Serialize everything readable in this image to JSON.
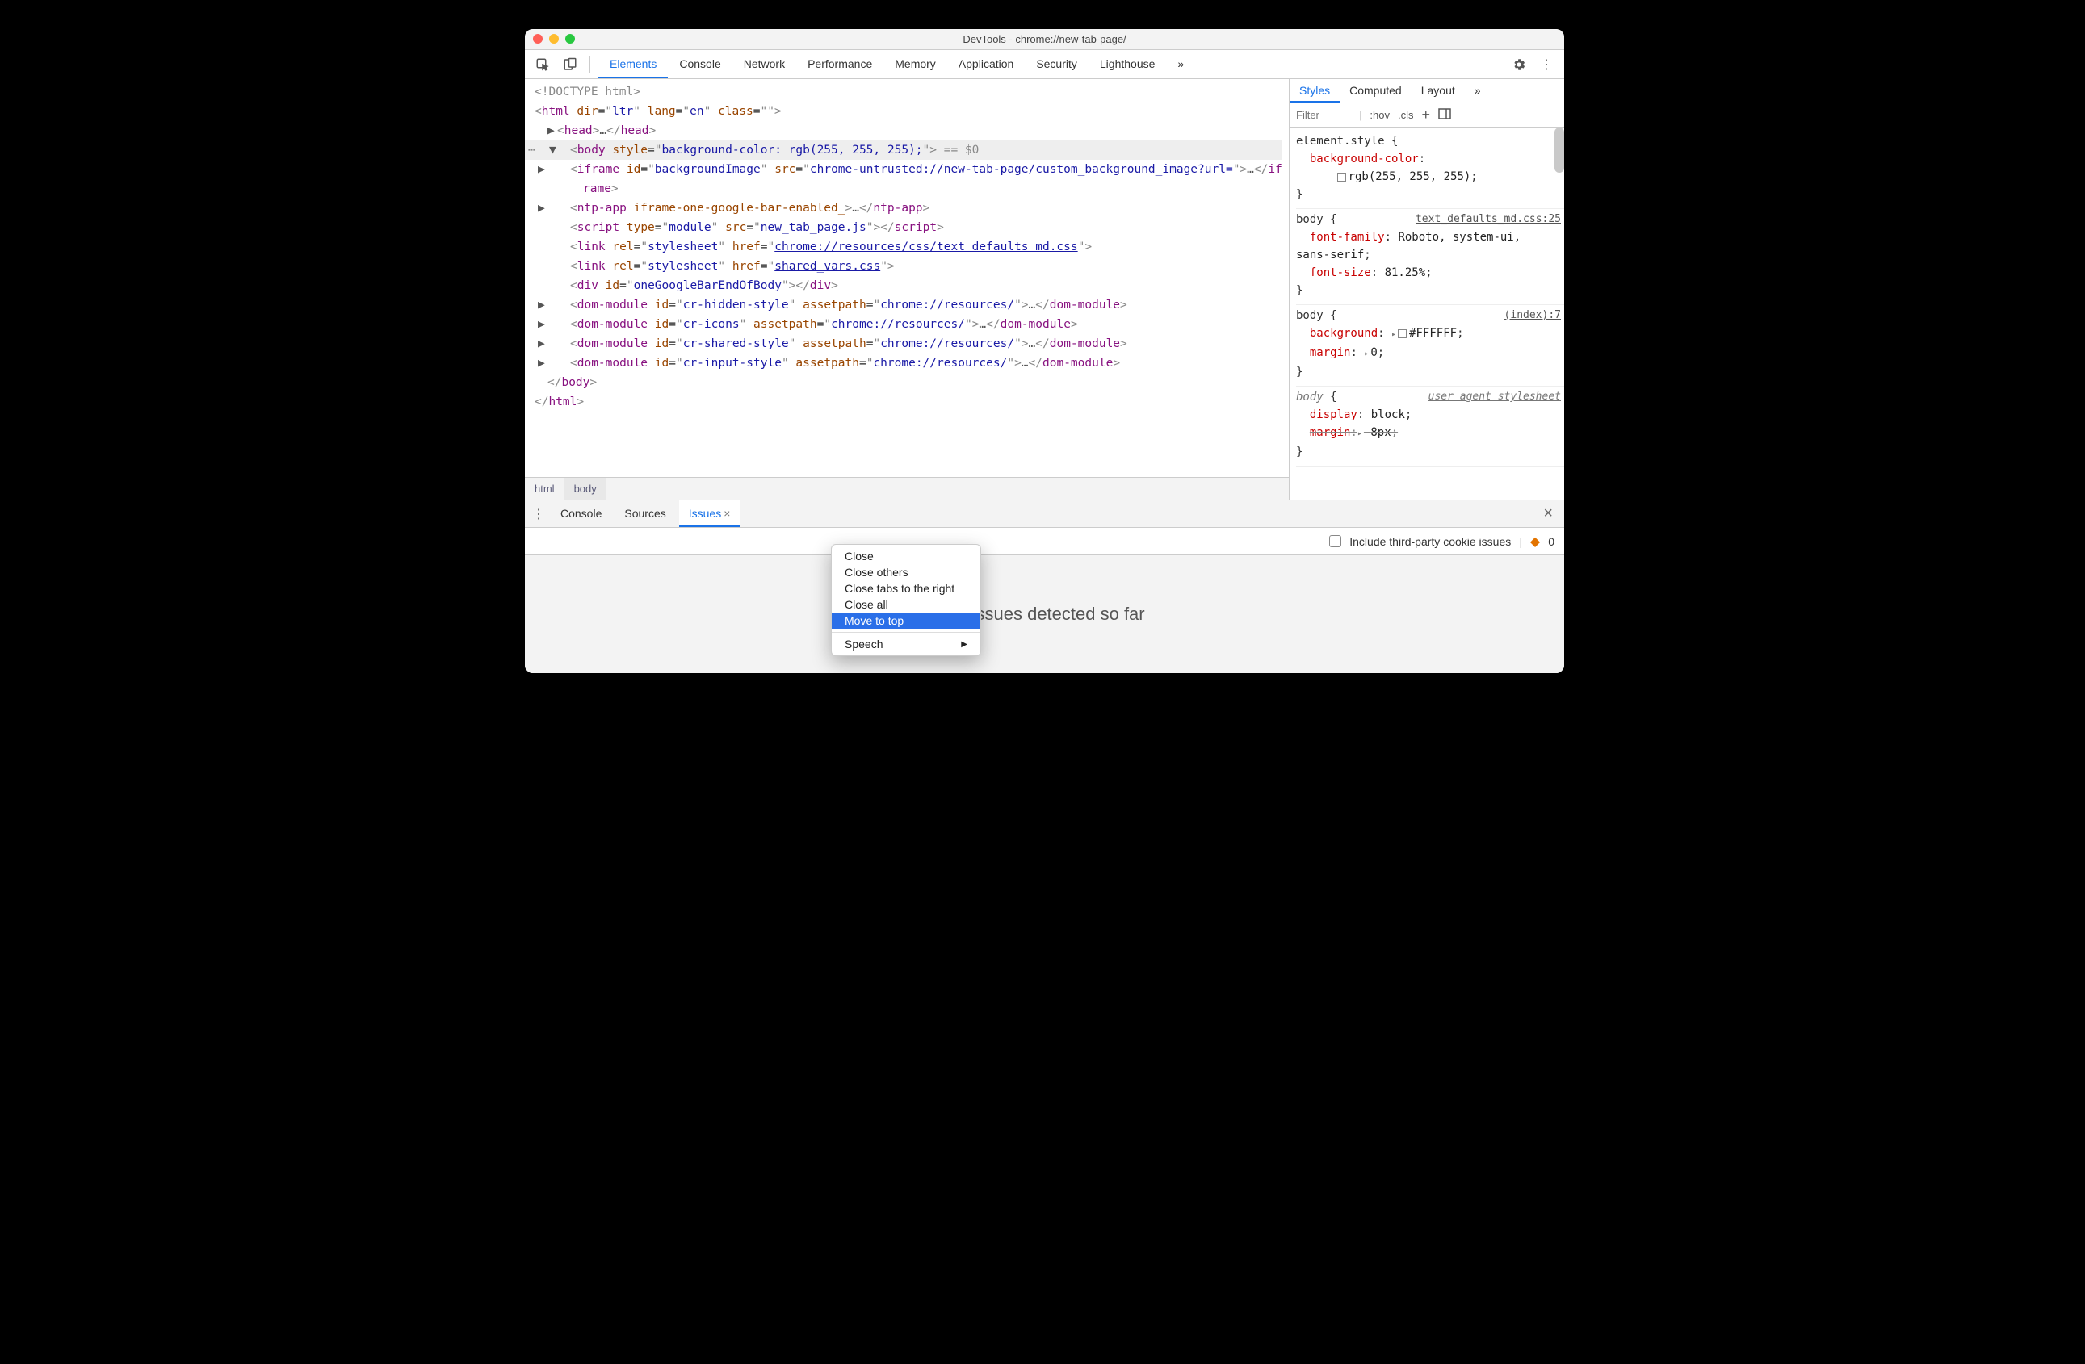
{
  "window": {
    "title": "DevTools - chrome://new-tab-page/"
  },
  "toolbar": {
    "tabs": [
      "Elements",
      "Console",
      "Network",
      "Performance",
      "Memory",
      "Application",
      "Security",
      "Lighthouse"
    ],
    "active": 0,
    "more": "»"
  },
  "dom": {
    "doctype": "<!DOCTYPE html>",
    "html_open": {
      "tag": "html",
      "attrs": [
        [
          "dir",
          "ltr"
        ],
        [
          "lang",
          "en"
        ],
        [
          "class",
          ""
        ]
      ]
    },
    "head": {
      "tag": "head",
      "ellipsis": "…"
    },
    "body": {
      "tag": "body",
      "style_attr": "background-color: rgb(255, 255, 255);",
      "suffix": " == $0"
    },
    "children": [
      {
        "open": "iframe",
        "attrs": [
          [
            "id",
            "backgroundImage"
          ],
          [
            "src",
            "chrome-untrusted://new-tab-page/custom_background_image?url=",
            "link"
          ]
        ],
        "ellipsis": "…",
        "close": "iframe",
        "arrow": true
      },
      {
        "open": "ntp-app",
        "attrs": [
          [
            "iframe-one-google-bar-enabled_",
            null
          ]
        ],
        "ellipsis": "…",
        "close": "ntp-app",
        "arrow": true
      },
      {
        "open": "script",
        "attrs": [
          [
            "type",
            "module"
          ],
          [
            "src",
            "new_tab_page.js",
            "link"
          ]
        ],
        "close": "script"
      },
      {
        "open": "link",
        "attrs": [
          [
            "rel",
            "stylesheet"
          ],
          [
            "href",
            "chrome://resources/css/text_defaults_md.css",
            "link"
          ]
        ]
      },
      {
        "open": "link",
        "attrs": [
          [
            "rel",
            "stylesheet"
          ],
          [
            "href",
            "shared_vars.css",
            "link"
          ]
        ]
      },
      {
        "open": "div",
        "attrs": [
          [
            "id",
            "oneGoogleBarEndOfBody"
          ]
        ],
        "close": "div"
      },
      {
        "open": "dom-module",
        "attrs": [
          [
            "id",
            "cr-hidden-style"
          ],
          [
            "assetpath",
            "chrome://resources/"
          ]
        ],
        "ellipsis": "…",
        "close": "dom-module",
        "arrow": true
      },
      {
        "open": "dom-module",
        "attrs": [
          [
            "id",
            "cr-icons"
          ],
          [
            "assetpath",
            "chrome://resources/"
          ]
        ],
        "ellipsis": "…",
        "close": "dom-module",
        "arrow": true
      },
      {
        "open": "dom-module",
        "attrs": [
          [
            "id",
            "cr-shared-style"
          ],
          [
            "assetpath",
            "chrome://resources/"
          ]
        ],
        "ellipsis": "…",
        "close": "dom-module",
        "arrow": true
      },
      {
        "open": "dom-module",
        "attrs": [
          [
            "id",
            "cr-input-style"
          ],
          [
            "assetpath",
            "chrome://resources/"
          ]
        ],
        "ellipsis": "…",
        "close": "dom-module",
        "arrow": true
      }
    ],
    "body_close": "body",
    "html_close": "html"
  },
  "breadcrumbs": [
    "html",
    "body"
  ],
  "styles": {
    "tabs": [
      "Styles",
      "Computed",
      "Layout"
    ],
    "more": "»",
    "filter_plh": "Filter",
    "hov": ":hov",
    "cls": ".cls",
    "rules": [
      {
        "selector": "element.style",
        "props": [
          [
            "background-color",
            "rgb(255, 255, 255)",
            "swatch"
          ]
        ]
      },
      {
        "selector": "body",
        "source": "text_defaults_md.css:25",
        "props": [
          [
            "font-family",
            "Roboto, system-ui, sans-serif"
          ],
          [
            "font-size",
            "81.25%"
          ]
        ]
      },
      {
        "selector": "body",
        "source": "(index):7",
        "props": [
          [
            "background",
            "#FFFFFF",
            "expand-swatch"
          ],
          [
            "margin",
            "0",
            "expand"
          ]
        ]
      },
      {
        "selector": "body",
        "source": "user agent stylesheet",
        "italic": true,
        "props": [
          [
            "display",
            "block"
          ],
          [
            "margin",
            "8px",
            "strike-expand"
          ]
        ]
      }
    ]
  },
  "drawer": {
    "tabs": [
      "Console",
      "Sources",
      "Issues"
    ],
    "active": 2,
    "include_third_party": "Include third-party cookie issues",
    "issues_count": "0",
    "no_issues": "No issues detected so far"
  },
  "context_menu": {
    "items": [
      "Close",
      "Close others",
      "Close tabs to the right",
      "Close all",
      "Move to top"
    ],
    "selected": 4,
    "speech": "Speech"
  }
}
